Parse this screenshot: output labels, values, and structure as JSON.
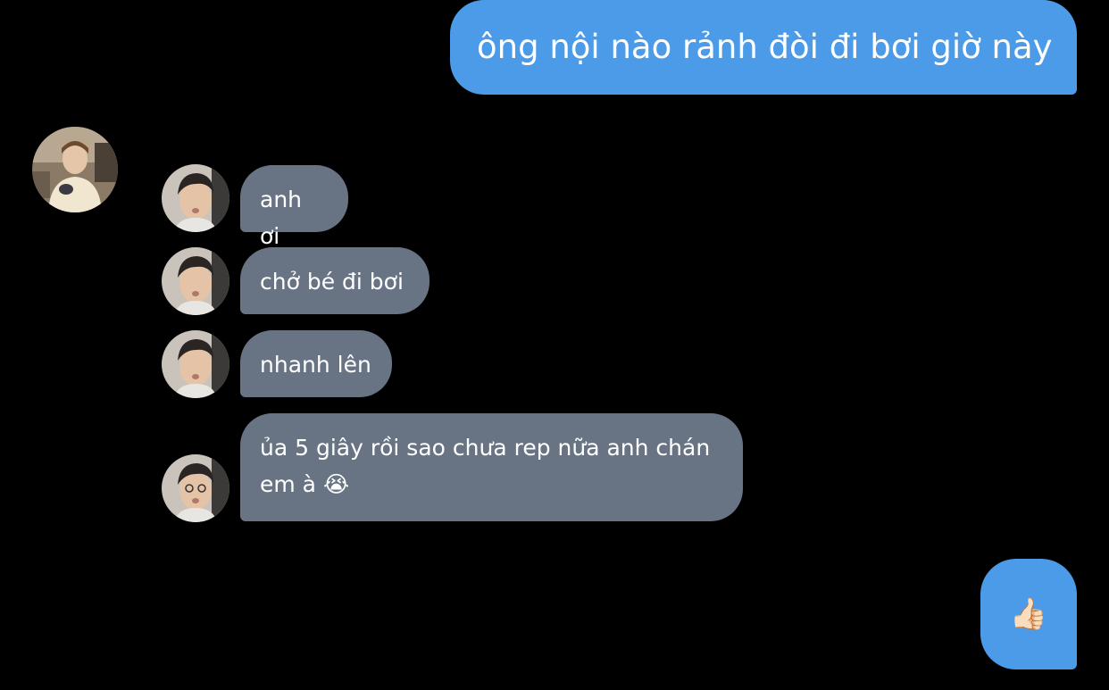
{
  "conversation": {
    "outgoing_1": "ông nội nào rảnh đòi đi bơi giờ này",
    "incoming": [
      {
        "text": "anh ơi"
      },
      {
        "text": "chở bé đi bơi"
      },
      {
        "text": "nhanh lên"
      },
      {
        "text_line1": "ủa 5 giây rồi sao chưa rep nữa anh chán",
        "text_line2": "em à 😭"
      }
    ],
    "outgoing_2": "👍🏻"
  },
  "colors": {
    "background": "#000000",
    "outgoing_bubble": "#4b9be8",
    "incoming_bubble": "#687483",
    "text": "#ffffff"
  },
  "icons": {
    "contact_avatar": "profile-photo-avatar",
    "message_avatar": "sender-photo-avatar"
  }
}
